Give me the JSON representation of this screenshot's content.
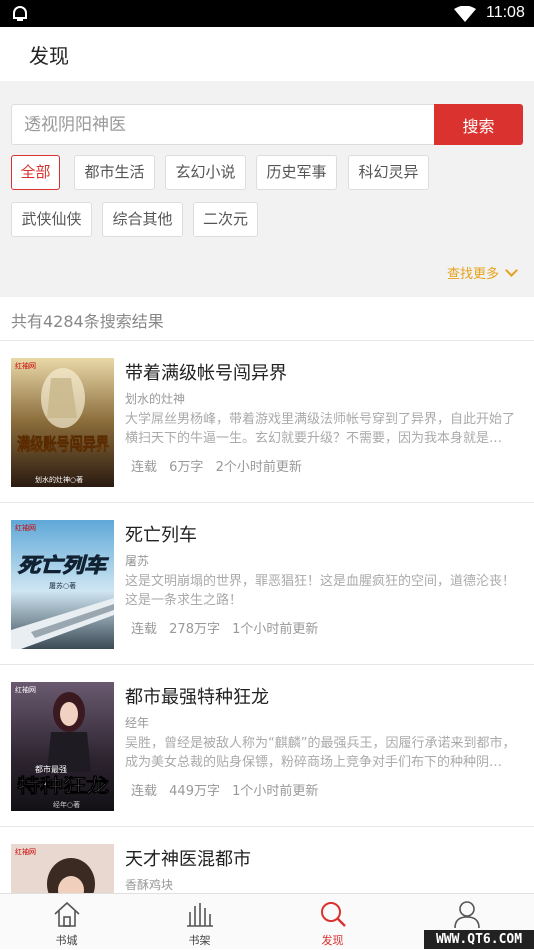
{
  "status": {
    "time": "11:08"
  },
  "header": {
    "title": "发现"
  },
  "search": {
    "placeholder": "透视阴阳神医",
    "button": "搜索"
  },
  "tags": [
    "全部",
    "都市生活",
    "玄幻小说",
    "历史军事",
    "科幻灵异",
    "武侠仙侠",
    "综合其他",
    "二次元"
  ],
  "more_label": "查找更多",
  "result_count": "共有4284条搜索结果",
  "books": [
    {
      "title": "带着满级帐号闯异界",
      "author": "划水的灶神",
      "desc": "大学屌丝男杨峰，带着游戏里满级法师帐号穿到了异界，自此开始了横扫天下的牛逼一生。玄幻就要升级？不需要，因为我本身就是…",
      "status": "连载",
      "words": "6万字",
      "updated": "2个小时前更新",
      "cover_text": "满级账号闯异界",
      "cover_author": "划水的灶神○著",
      "cover_site": "红袖网"
    },
    {
      "title": "死亡列车",
      "author": "屠苏",
      "desc": "这是文明崩塌的世界，罪恶猖狂！这是血腥疯狂的空间，道德沦丧！这是一条求生之路！",
      "status": "连载",
      "words": "278万字",
      "updated": "1个小时前更新",
      "cover_text": "死亡列车",
      "cover_author": "屠苏○著",
      "cover_site": "红袖网"
    },
    {
      "title": "都市最强特种狂龙",
      "author": "经年",
      "desc": "吴胜，曾经是被敌人称为“麒麟”的最强兵王，因履行承诺来到都市，成为美女总裁的贴身保镖，粉碎商场上竞争对手们布下的种种阴…",
      "status": "连载",
      "words": "449万字",
      "updated": "1个小时前更新",
      "cover_text": "特种狂龙",
      "cover_subtext": "都市最强",
      "cover_author": "经年○著",
      "cover_site": "红袖网"
    },
    {
      "title": "天才神医混都市",
      "author": "香酥鸡块",
      "desc": "",
      "status": "",
      "words": "",
      "updated": "",
      "cover_site": "红袖网"
    }
  ],
  "tabbar": [
    {
      "label": "书城",
      "icon": "home-icon"
    },
    {
      "label": "书架",
      "icon": "bookshelf-icon"
    },
    {
      "label": "发现",
      "icon": "search-icon"
    },
    {
      "label": "",
      "icon": "user-icon"
    }
  ],
  "watermark": "WWW.QT6.COM",
  "colors": {
    "accent": "#d9322f",
    "more": "#e7a21b"
  }
}
